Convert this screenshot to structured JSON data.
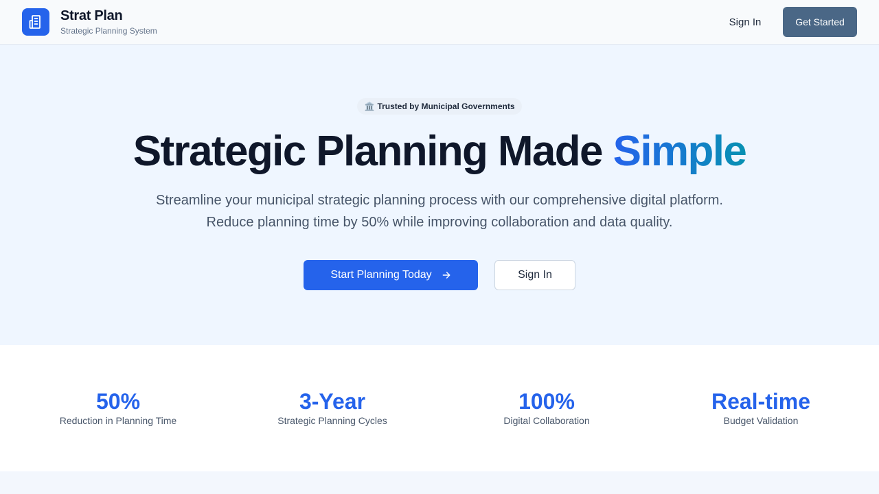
{
  "header": {
    "logo_icon": "building-icon",
    "title": "Strat Plan",
    "subtitle": "Strategic Planning System",
    "sign_in_label": "Sign In",
    "get_started_label": "Get Started"
  },
  "hero": {
    "badge_icon": "government-building-icon",
    "badge_emoji": "🏛️",
    "badge_text": "Trusted by Municipal Governments",
    "title_main": "Strategic Planning Made ",
    "title_accent": "Simple",
    "subtitle_line1": "Streamline your municipal strategic planning process with our comprehensive digital platform.",
    "subtitle_line2": "Reduce planning time by 50% while improving collaboration and data quality.",
    "primary_cta_label": "Start Planning Today",
    "primary_cta_icon": "arrow-right-icon",
    "secondary_cta_label": "Sign In"
  },
  "stats": [
    {
      "value": "50%",
      "label": "Reduction in Planning Time"
    },
    {
      "value": "3-Year",
      "label": "Strategic Planning Cycles"
    },
    {
      "value": "100%",
      "label": "Digital Collaboration"
    },
    {
      "value": "Real-time",
      "label": "Budget Validation"
    }
  ],
  "colors": {
    "primary": "#2563eb",
    "accent_gradient_end": "#0891b2",
    "nav_button": "#4a6786",
    "hero_bg": "#eff6ff"
  }
}
